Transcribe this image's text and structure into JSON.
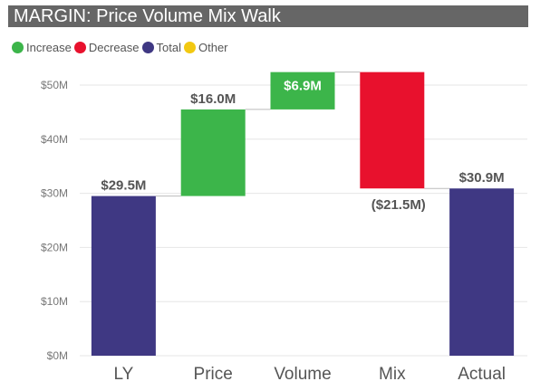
{
  "title": "MARGIN: Price Volume Mix Walk",
  "legend": [
    {
      "label": "Increase",
      "color": "#3cb54a"
    },
    {
      "label": "Decrease",
      "color": "#e8112d"
    },
    {
      "label": "Total",
      "color": "#3f3883"
    },
    {
      "label": "Other",
      "color": "#f2c811"
    }
  ],
  "chart_data": {
    "type": "bar",
    "subtype": "waterfall",
    "title": "MARGIN: Price Volume Mix Walk",
    "categories": [
      "LY",
      "Price",
      "Volume",
      "Mix",
      "Actual"
    ],
    "values": [
      29.5,
      16.0,
      6.9,
      -21.5,
      30.9
    ],
    "kinds": [
      "Total",
      "Increase",
      "Increase",
      "Decrease",
      "Total"
    ],
    "data_labels": [
      "$29.5M",
      "$16.0M",
      "$6.9M",
      "($21.5M)",
      "$30.9M"
    ],
    "yticks": [
      "$0M",
      "$10M",
      "$20M",
      "$30M",
      "$40M",
      "$50M"
    ],
    "ylim": [
      0,
      50
    ],
    "grid": true,
    "legend_position": "top-left"
  }
}
